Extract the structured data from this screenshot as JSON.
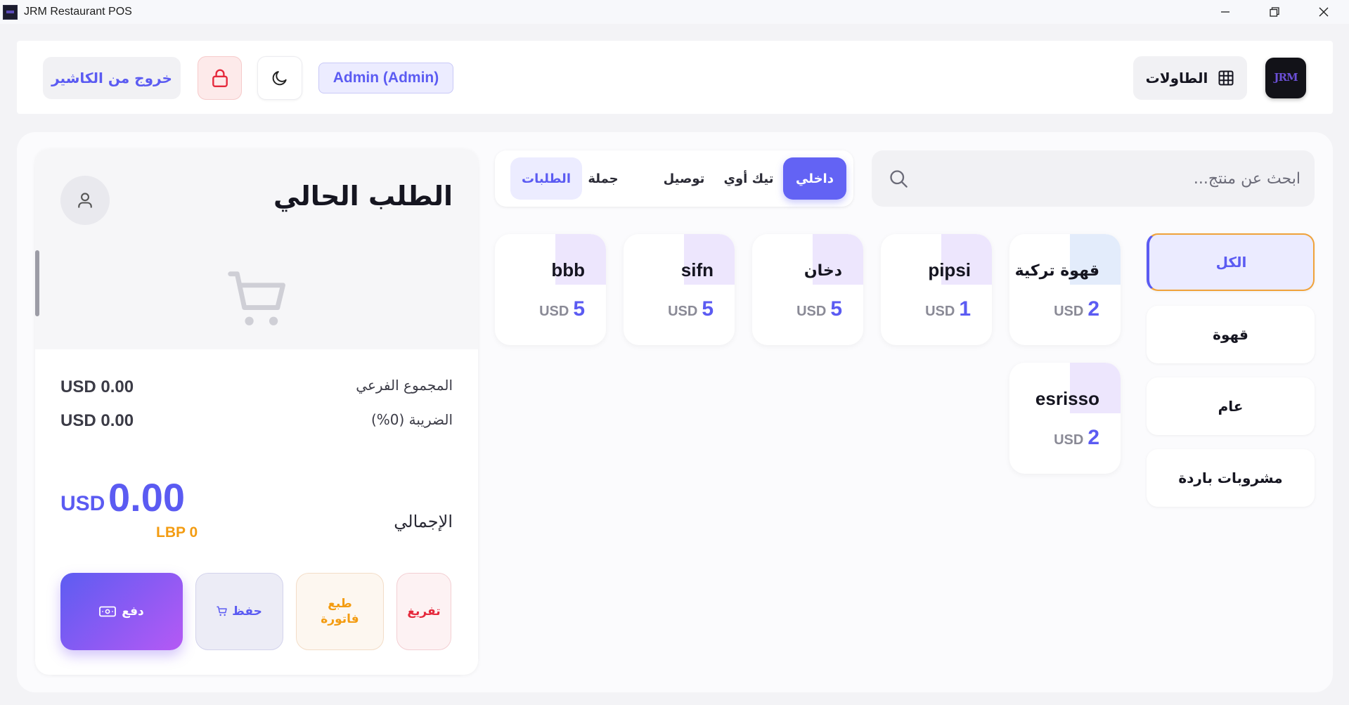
{
  "window": {
    "title": "JRM Restaurant POS"
  },
  "header": {
    "logo_text": "JRM",
    "tables_label": "الطاولات",
    "user_badge": "Admin (Admin)",
    "logout_label": "خروج من الكاشير"
  },
  "categories": [
    {
      "label": "الكل",
      "active": true
    },
    {
      "label": "قهوة",
      "active": false
    },
    {
      "label": "عام",
      "active": false
    },
    {
      "label": "مشروبات باردة",
      "active": false
    }
  ],
  "search": {
    "placeholder": "ابحث عن منتج..."
  },
  "order_types": [
    {
      "label": "داخلي",
      "active": true
    },
    {
      "label": "تيك أوي",
      "active": false
    },
    {
      "label": "توصيل",
      "active": false
    },
    {
      "label": "جملة",
      "active": false
    },
    {
      "label": "الطلبات",
      "active": false
    }
  ],
  "products": [
    {
      "name": "قهوة تركية",
      "currency": "USD",
      "price": "2"
    },
    {
      "name": "pipsi",
      "currency": "USD",
      "price": "1"
    },
    {
      "name": "دخان",
      "currency": "USD",
      "price": "5"
    },
    {
      "name": "sifn",
      "currency": "USD",
      "price": "5"
    },
    {
      "name": "bbb",
      "currency": "USD",
      "price": "5"
    },
    {
      "name": "esrisso",
      "currency": "USD",
      "price": "2"
    }
  ],
  "order": {
    "title": "الطلب الحالي",
    "subtotal_label": "المجموع الفرعي",
    "subtotal_value": "USD 0.00",
    "tax_label": "الضريبة (0%)",
    "tax_value": "USD 0.00",
    "total_label": "الإجمالي",
    "total_currency": "USD",
    "total_value": "0.00",
    "total_lbp": "LBP 0"
  },
  "actions": {
    "pay_label": "دفع",
    "save_label": "حفظ",
    "print_line1": "طبع",
    "print_line2": "فاتورة",
    "clear_label": "تفريغ"
  },
  "colors": {
    "accent": "#5b5bf2",
    "danger": "#e5293c",
    "warning": "#f39c12",
    "background": "#f3f3f6"
  }
}
